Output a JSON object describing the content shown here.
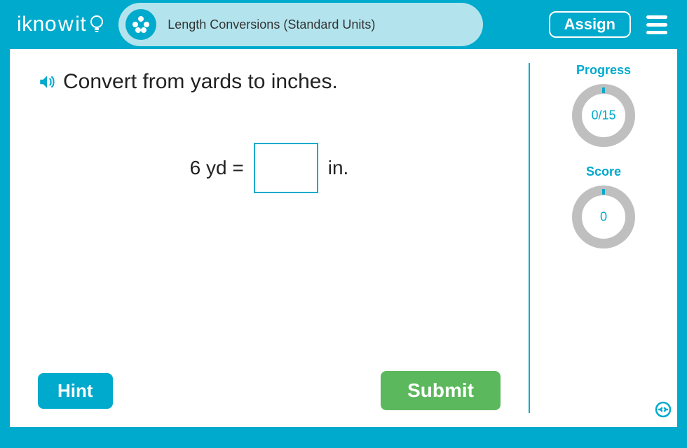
{
  "header": {
    "logo_text_1": "ikno",
    "logo_text_2": "it",
    "lesson_title": "Length Conversions (Standard Units)",
    "assign_label": "Assign"
  },
  "question": {
    "prompt": "Convert from yards to inches.",
    "left": "6 yd =",
    "right": "in.",
    "input_value": ""
  },
  "buttons": {
    "hint": "Hint",
    "submit": "Submit"
  },
  "side": {
    "progress_label": "Progress",
    "progress_value": "0/15",
    "score_label": "Score",
    "score_value": "0"
  }
}
